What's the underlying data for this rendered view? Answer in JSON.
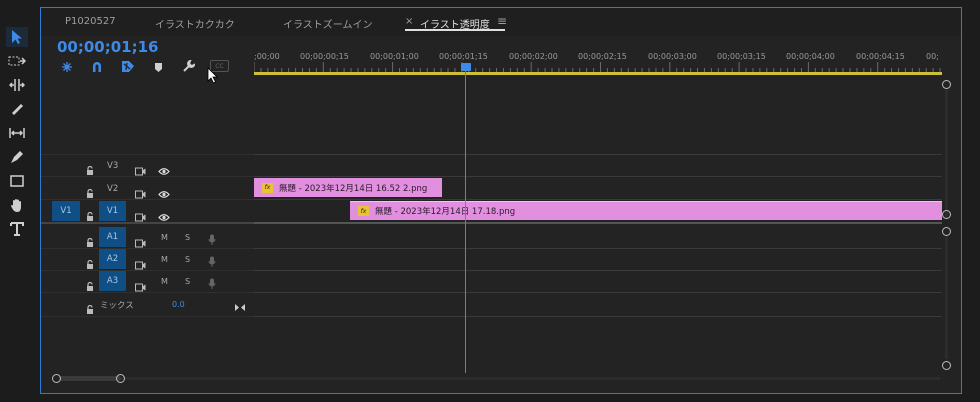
{
  "tabs": [
    {
      "label": "P1020527"
    },
    {
      "label": "イラストカクカク"
    },
    {
      "label": "イラストズームイン"
    },
    {
      "label": "イラスト透明度",
      "active": true
    }
  ],
  "tab_close_glyph": "×",
  "tab_menu_glyph": "≡",
  "timecode": "00;00;01;16",
  "ruler_labels": [
    ";00;00",
    "00;00;00;15",
    "00;00;01;00",
    "00;00;01;15",
    "00;00;02;00",
    "00;00;02;15",
    "00;00;03;00",
    "00;00;03;15",
    "00;00;04;00",
    "00;00;04;15",
    "00;"
  ],
  "video_tracks": [
    {
      "name": "V3",
      "source": ""
    },
    {
      "name": "V2",
      "source": ""
    },
    {
      "name": "V1",
      "source": "V1"
    }
  ],
  "audio_tracks": [
    {
      "name": "A1",
      "m": "M",
      "s": "S"
    },
    {
      "name": "A2",
      "m": "M",
      "s": "S"
    },
    {
      "name": "A3",
      "m": "M",
      "s": "S"
    }
  ],
  "mix": {
    "label": "ミックス",
    "value": "0.0"
  },
  "clips": [
    {
      "track": "V2",
      "name": "無題 - 2023年12月14日 16.52 2.png",
      "fx": "fx"
    },
    {
      "track": "V1",
      "name": "無題 - 2023年12月14日 17.18.png",
      "fx": "fx"
    }
  ],
  "header_icons": [
    "nest-sequence-icon",
    "snap-magnet-icon",
    "linked-selection-icon",
    "add-marker-icon",
    "timeline-settings-wrench-icon",
    "captions-cc-icon"
  ],
  "tools": [
    "selection-arrow-icon",
    "track-select-icon",
    "ripple-edit-icon",
    "razor-icon",
    "slip-icon",
    "pen-icon",
    "rectangle-icon",
    "hand-icon",
    "type-icon"
  ],
  "captions_label": "CC",
  "colors": {
    "accent": "#3d8ae8",
    "clip": "#e28fe0",
    "workarea": "#cdbf3a",
    "patch": "#0f4f85"
  }
}
